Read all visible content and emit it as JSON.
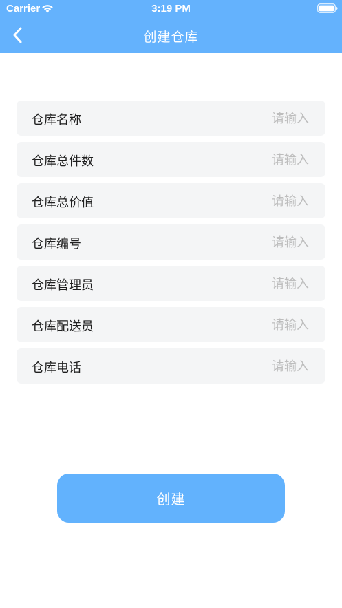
{
  "status_bar": {
    "carrier": "Carrier",
    "time": "3:19 PM"
  },
  "nav": {
    "title": "创建仓库",
    "back_icon": "chevron-left-icon"
  },
  "form": {
    "rows": [
      {
        "label": "仓库名称",
        "placeholder": "请输入"
      },
      {
        "label": "仓库总件数",
        "placeholder": "请输入"
      },
      {
        "label": "仓库总价值",
        "placeholder": "请输入"
      },
      {
        "label": "仓库编号",
        "placeholder": "请输入"
      },
      {
        "label": "仓库管理员",
        "placeholder": "请输入"
      },
      {
        "label": "仓库配送员",
        "placeholder": "请输入"
      },
      {
        "label": "仓库电话",
        "placeholder": "请输入"
      }
    ]
  },
  "create_button": {
    "label": "创建"
  },
  "colors": {
    "header": "#64b2fd",
    "button": "#62b2fd",
    "row_background": "#f4f5f6",
    "placeholder": "#bdbdbd"
  }
}
